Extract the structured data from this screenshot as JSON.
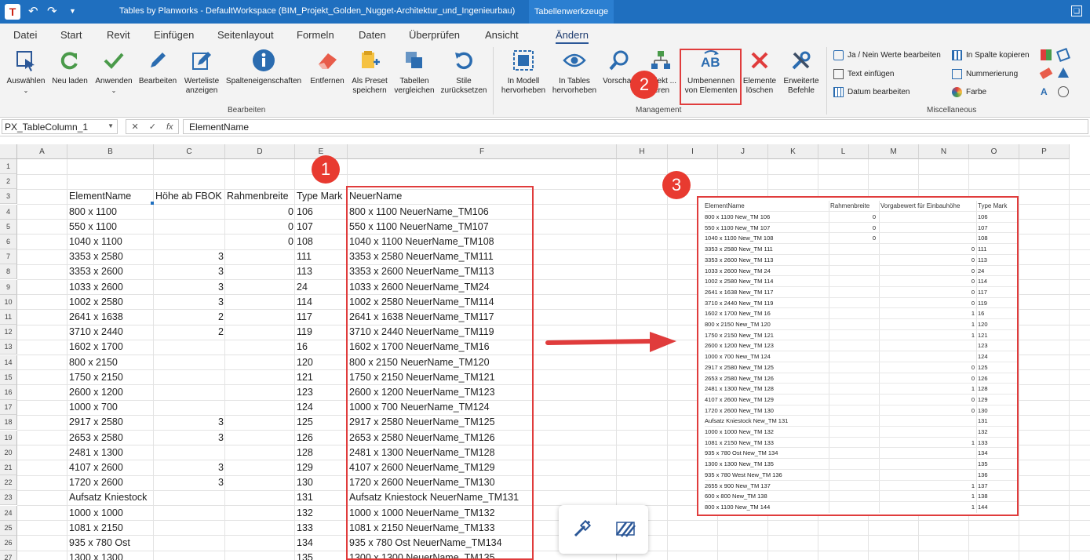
{
  "window": {
    "title": "Tables by Planworks - DefaultWorkspace  (BIM_Projekt_Golden_Nugget-Architektur_und_Ingenieurbau)",
    "context_tab": "Tabellenwerkzeuge"
  },
  "menu": [
    "Datei",
    "Start",
    "Revit",
    "Einfügen",
    "Seitenlayout",
    "Formeln",
    "Daten",
    "Überprüfen",
    "Ansicht",
    "Ändern"
  ],
  "ribbon": {
    "bearbeiten": [
      {
        "label": "Auswählen",
        "icon": "select-cursor-icon"
      },
      {
        "label": "Neu laden",
        "icon": "reload-icon"
      },
      {
        "label": "Anwenden",
        "icon": "check-icon"
      },
      {
        "label": "Bearbeiten",
        "icon": "pencil-icon"
      },
      {
        "label": "Werteliste anzeigen",
        "icon": "edit-list-icon"
      },
      {
        "label": "Spalteneigenschaften",
        "icon": "info-icon"
      },
      {
        "label": "Entfernen",
        "icon": "eraser-icon"
      },
      {
        "label": "Als Preset speichern",
        "icon": "save-preset-icon"
      },
      {
        "label": "Tabellen vergleichen",
        "icon": "compare-icon"
      },
      {
        "label": "Stile zurücksetzen",
        "icon": "reset-icon"
      }
    ],
    "bearbeiten_group": "Bearbeiten",
    "management": [
      {
        "label": "In Modell hervorheben",
        "icon": "highlight-model-icon"
      },
      {
        "label": "In Tables hervorheben",
        "icon": "eye-icon"
      },
      {
        "label": "Vorschau",
        "icon": "magnifier-icon"
      },
      {
        "label": "Objekt ... ieren",
        "icon": "hierarchy-icon"
      },
      {
        "label": "Umbenennen von Elementen",
        "icon": "rename-ab-icon"
      },
      {
        "label": "Elemente löschen",
        "icon": "delete-x-icon"
      },
      {
        "label": "Erweiterte Befehle",
        "icon": "tools-icon"
      }
    ],
    "management_group": "Management",
    "misc": [
      {
        "label": "Ja / Nein Werte bearbeiten",
        "icon": "yes-no-icon"
      },
      {
        "label": "Text einfügen",
        "icon": "text-insert-icon"
      },
      {
        "label": "Datum bearbeiten",
        "icon": "calendar-icon"
      },
      {
        "label": "In Spalte kopieren",
        "icon": "copy-column-icon"
      },
      {
        "label": "Nummerierung",
        "icon": "numbering-icon"
      },
      {
        "label": "Farbe",
        "icon": "color-wheel-icon"
      }
    ],
    "misc_group": "Miscellaneous"
  },
  "formula": {
    "name_box": "PX_TableColumn_1",
    "value": "ElementName",
    "fx": "fx"
  },
  "columns": [
    "A",
    "B",
    "C",
    "D",
    "E",
    "F",
    "H",
    "I",
    "J",
    "K",
    "L",
    "M",
    "N",
    "O",
    "P"
  ],
  "sheet": {
    "headers": [
      "ElementName",
      "Höhe ab FBOK",
      "Rahmenbreite",
      "Type Mark",
      "NeuerName"
    ],
    "rows": [
      [
        "800 x 1100",
        "",
        "0",
        "106",
        "800 x 1100 NeuerName_TM106"
      ],
      [
        "550 x 1100",
        "",
        "0",
        "107",
        "550 x 1100 NeuerName_TM107"
      ],
      [
        "1040 x 1100",
        "",
        "0",
        "108",
        "1040 x 1100 NeuerName_TM108"
      ],
      [
        "3353 x 2580",
        "3",
        "",
        "111",
        "3353 x 2580 NeuerName_TM111"
      ],
      [
        "3353 x 2600",
        "3",
        "",
        "113",
        "3353 x 2600 NeuerName_TM113"
      ],
      [
        "1033 x 2600",
        "3",
        "",
        "24",
        "1033 x 2600 NeuerName_TM24"
      ],
      [
        "1002 x 2580",
        "3",
        "",
        "114",
        "1002 x 2580 NeuerName_TM114"
      ],
      [
        "2641 x 1638",
        "2",
        "",
        "117",
        "2641 x 1638 NeuerName_TM117"
      ],
      [
        "3710 x 2440",
        "2",
        "",
        "119",
        "3710 x 2440 NeuerName_TM119"
      ],
      [
        "1602 x 1700",
        "",
        "",
        "16",
        "1602 x 1700 NeuerName_TM16"
      ],
      [
        "800 x 2150",
        "",
        "",
        "120",
        "800 x 2150 NeuerName_TM120"
      ],
      [
        "1750 x 2150",
        "",
        "",
        "121",
        "1750 x 2150 NeuerName_TM121"
      ],
      [
        "2600 x 1200",
        "",
        "",
        "123",
        "2600 x 1200 NeuerName_TM123"
      ],
      [
        "1000 x 700",
        "",
        "",
        "124",
        "1000 x 700 NeuerName_TM124"
      ],
      [
        "2917 x 2580",
        "3",
        "",
        "125",
        "2917 x 2580 NeuerName_TM125"
      ],
      [
        "2653 x 2580",
        "3",
        "",
        "126",
        "2653 x 2580 NeuerName_TM126"
      ],
      [
        "2481 x 1300",
        "",
        "",
        "128",
        "2481 x 1300 NeuerName_TM128"
      ],
      [
        "4107 x 2600",
        "3",
        "",
        "129",
        "4107 x 2600 NeuerName_TM129"
      ],
      [
        "1720 x 2600",
        "3",
        "",
        "130",
        "1720 x 2600 NeuerName_TM130"
      ],
      [
        "Aufsatz Kniestock",
        "",
        "",
        "131",
        "Aufsatz Kniestock NeuerName_TM131"
      ],
      [
        "1000 x 1000",
        "",
        "",
        "132",
        "1000 x 1000 NeuerName_TM132"
      ],
      [
        "1081 x 2150",
        "",
        "",
        "133",
        "1081 x 2150 NeuerName_TM133"
      ],
      [
        "935 x 780 Ost",
        "",
        "",
        "134",
        "935 x 780 Ost NeuerName_TM134"
      ],
      [
        "1300 x 1300",
        "",
        "",
        "135",
        "1300 x 1300 NeuerName_TM135"
      ]
    ]
  },
  "inset": {
    "headers": [
      "ElementName",
      "Rahmenbreite",
      "Vorgabewert für Einbauhöhe",
      "Type Mark"
    ],
    "rows": [
      [
        "800 x 1100 New_TM 106",
        "0",
        "",
        "106"
      ],
      [
        "550 x 1100 New_TM 107",
        "0",
        "",
        "107"
      ],
      [
        "1040 x 1100 New_TM 108",
        "0",
        "",
        "108"
      ],
      [
        "3353 x 2580 New_TM 111",
        "",
        "0",
        "111"
      ],
      [
        "3353 x 2600 New_TM 113",
        "",
        "0",
        "113"
      ],
      [
        "1033 x 2600 New_TM 24",
        "",
        "0",
        "24"
      ],
      [
        "1002 x 2580 New_TM 114",
        "",
        "0",
        "114"
      ],
      [
        "2641 x 1638 New_TM 117",
        "",
        "0",
        "117"
      ],
      [
        "3710 x 2440 New_TM 119",
        "",
        "0",
        "119"
      ],
      [
        "1602 x 1700 New_TM 16",
        "",
        "1",
        "16"
      ],
      [
        "800 x 2150 New_TM 120",
        "",
        "1",
        "120"
      ],
      [
        "1750 x 2150 New_TM 121",
        "",
        "1",
        "121"
      ],
      [
        "2600 x 1200 New_TM 123",
        "",
        "",
        "123"
      ],
      [
        "1000 x 700 New_TM 124",
        "",
        "",
        "124"
      ],
      [
        "2917 x 2580 New_TM 125",
        "",
        "0",
        "125"
      ],
      [
        "2653 x 2580 New_TM 126",
        "",
        "0",
        "126"
      ],
      [
        "2481 x 1300 New_TM 128",
        "",
        "1",
        "128"
      ],
      [
        "4107 x 2600 New_TM 129",
        "",
        "0",
        "129"
      ],
      [
        "1720 x 2600 New_TM 130",
        "",
        "0",
        "130"
      ],
      [
        "Aufsatz Kniestock New_TM 131",
        "",
        "",
        "131"
      ],
      [
        "1000 x 1000 New_TM 132",
        "",
        "",
        "132"
      ],
      [
        "1081 x 2150 New_TM 133",
        "",
        "1",
        "133"
      ],
      [
        "935 x 780 Ost New_TM 134",
        "",
        "",
        "134"
      ],
      [
        "1300 x 1300 New_TM 135",
        "",
        "",
        "135"
      ],
      [
        "935 x 780 West New_TM 136",
        "",
        "",
        "136"
      ],
      [
        "2655 x 900 New_TM 137",
        "",
        "1",
        "137"
      ],
      [
        "600 x 800 New_TM 138",
        "",
        "1",
        "138"
      ],
      [
        "800 x 1100 New_TM 144",
        "",
        "1",
        "144"
      ]
    ]
  },
  "badges": [
    "1",
    "2",
    "3"
  ],
  "colors": {
    "accent": "#1f6fbf",
    "highlight": "#e03c3c"
  }
}
